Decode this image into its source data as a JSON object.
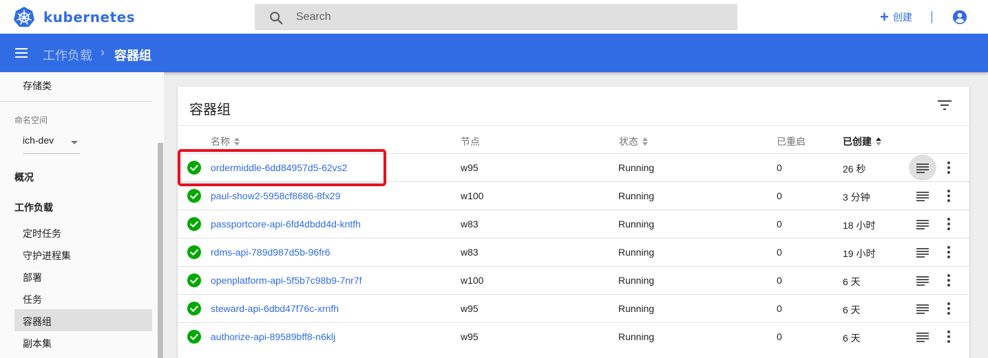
{
  "app": {
    "name": "kubernetes"
  },
  "search": {
    "placeholder": "Search"
  },
  "header": {
    "create_label": "创建"
  },
  "breadcrumb": {
    "parent": "工作负载",
    "separator": "›",
    "current": "容器组"
  },
  "sidebar": {
    "storage_class": "存储类",
    "namespace_label": "命名空间",
    "namespace_value": "ich-dev",
    "overview": "概况",
    "workloads": "工作负载",
    "items": [
      "定时任务",
      "守护进程集",
      "部署",
      "任务",
      "容器组",
      "副本集"
    ],
    "active_item": "容器组"
  },
  "card": {
    "title": "容器组",
    "columns": [
      "名称",
      "节点",
      "状态",
      "已重启",
      "已创建"
    ],
    "sorted_column": "已创建",
    "rows": [
      {
        "name": "ordermiddle-6dd84957d5-62vs2",
        "node": "w95",
        "status": "Running",
        "restarts": "0",
        "age": "26 秒"
      },
      {
        "name": "paul-show2-5958cf8686-8fx29",
        "node": "w100",
        "status": "Running",
        "restarts": "0",
        "age": "3 分钟"
      },
      {
        "name": "passportcore-api-6fd4dbdd4d-kntfh",
        "node": "w83",
        "status": "Running",
        "restarts": "0",
        "age": "18 小时"
      },
      {
        "name": "rdms-api-789d987d5b-96fr6",
        "node": "w83",
        "status": "Running",
        "restarts": "0",
        "age": "19 小时"
      },
      {
        "name": "openplatform-api-5f5b7c98b9-7nr7f",
        "node": "w100",
        "status": "Running",
        "restarts": "0",
        "age": "6 天"
      },
      {
        "name": "steward-api-6dbd47f76c-xrnfh",
        "node": "w95",
        "status": "Running",
        "restarts": "0",
        "age": "6 天"
      },
      {
        "name": "authorize-api-89589bff8-n6klj",
        "node": "w95",
        "status": "Running",
        "restarts": "0",
        "age": "6 天"
      }
    ]
  },
  "colors": {
    "brand": "#326ce5",
    "success": "#00a800",
    "highlight": "#e8101d"
  }
}
